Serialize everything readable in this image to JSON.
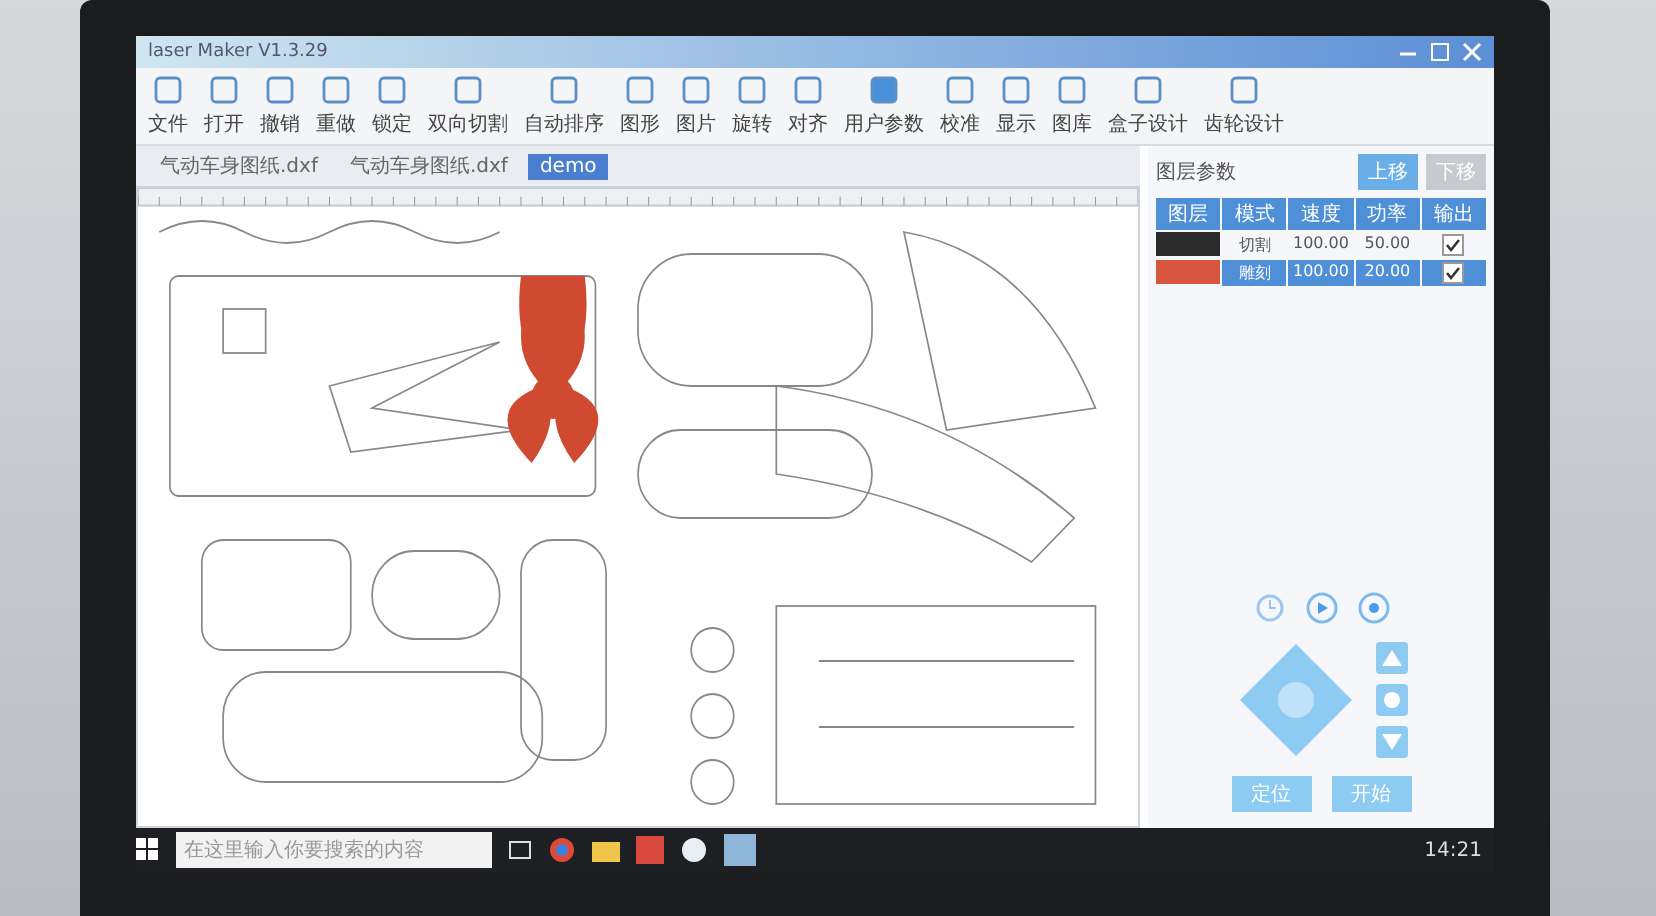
{
  "window": {
    "title": "laser Maker V1.3.29"
  },
  "toolbar": [
    {
      "label": "文件"
    },
    {
      "label": "打开"
    },
    {
      "label": "撤销"
    },
    {
      "label": "重做"
    },
    {
      "label": "锁定"
    },
    {
      "label": "双向切割"
    },
    {
      "label": "自动排序"
    },
    {
      "label": "图形"
    },
    {
      "label": "图片"
    },
    {
      "label": "旋转"
    },
    {
      "label": "对齐"
    },
    {
      "label": "用户参数"
    },
    {
      "label": "校准"
    },
    {
      "label": "显示"
    },
    {
      "label": "图库"
    },
    {
      "label": "盒子设计"
    },
    {
      "label": "齿轮设计"
    }
  ],
  "file_tabs": [
    {
      "label": "气动车身图纸.dxf",
      "selected": false
    },
    {
      "label": "气动车身图纸.dxf",
      "selected": false
    },
    {
      "label": "demo",
      "selected": true
    }
  ],
  "layer_panel": {
    "title": "图层参数",
    "buttons": [
      "上移",
      "下移"
    ],
    "columns": [
      "图层",
      "模式",
      "速度",
      "功率",
      "输出"
    ],
    "rows": [
      {
        "color": "#2b2b2b",
        "mode": "切割",
        "speed": "100.00",
        "power": "50.00",
        "output": true,
        "selected": false
      },
      {
        "color": "#d9553f",
        "mode": "雕刻",
        "speed": "100.00",
        "power": "20.00",
        "output": true,
        "selected": true
      }
    ]
  },
  "controls": {
    "buttons": [
      "定位",
      "开始"
    ]
  },
  "taskbar": {
    "search_placeholder": "在这里输入你要搜索的内容",
    "time": "14:21"
  }
}
